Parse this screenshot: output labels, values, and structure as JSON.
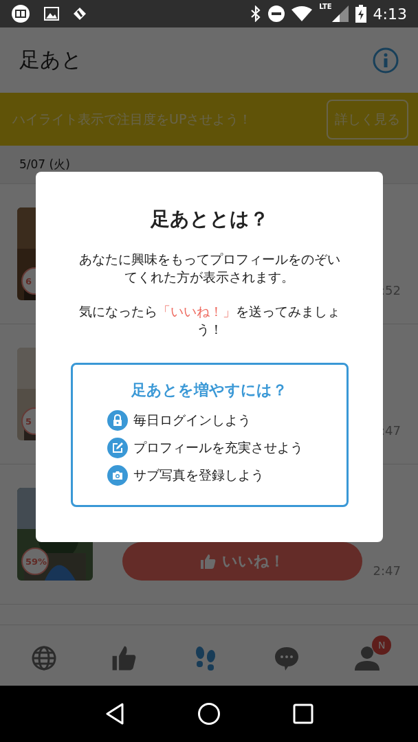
{
  "status_bar": {
    "network": "LTE",
    "time": "4:13"
  },
  "header": {
    "title": "足あと"
  },
  "banner": {
    "text": "ハイライト表示で注目度をUPさせよう！",
    "button": "詳しく見る"
  },
  "date": "5/07 (火)",
  "visitors": [
    {
      "match": "6",
      "time": ":52"
    },
    {
      "match": "5",
      "time": ":47"
    },
    {
      "match": "59%",
      "time": "2:47",
      "like_button": "いいね！"
    }
  ],
  "bottom_nav": [
    {
      "kind": "explore",
      "selected": false
    },
    {
      "kind": "likes",
      "selected": false
    },
    {
      "kind": "footprints",
      "selected": true
    },
    {
      "kind": "messages",
      "selected": false
    },
    {
      "kind": "profile",
      "selected": false,
      "badge": "N"
    }
  ],
  "dialog": {
    "title": "足あととは？",
    "paragraphs": [
      {
        "before": "あなたに興味をもってプロフィールをのぞいてくれた方が表示されます。"
      },
      {
        "before": "気になったら",
        "highlight": "「いいね！」",
        "after": "を送ってみましょう！"
      }
    ],
    "tips": {
      "title": "足あとを増やすには？",
      "items": [
        {
          "kind": "lock",
          "text": "毎日ログインしよう"
        },
        {
          "kind": "edit",
          "text": "プロフィールを充実させよう"
        },
        {
          "kind": "camera",
          "text": "サブ写真を登録しよう"
        }
      ]
    }
  }
}
